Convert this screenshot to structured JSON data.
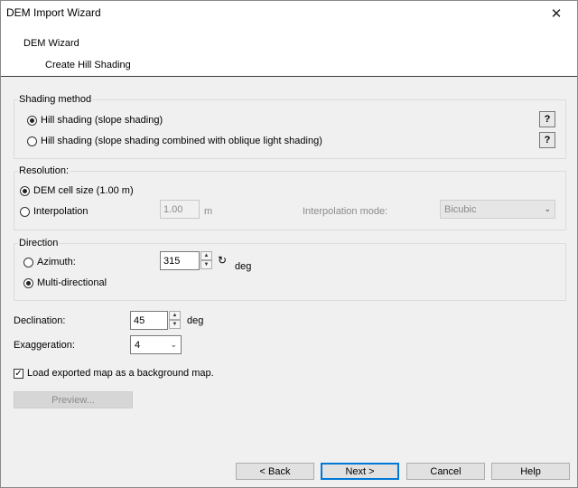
{
  "window": {
    "title": "DEM Import Wizard",
    "close_glyph": "✕"
  },
  "header": {
    "step_title": "DEM Wizard",
    "step_subtitle": "Create Hill Shading"
  },
  "shading": {
    "legend": "Shading method",
    "options": [
      {
        "label": "Hill shading (slope shading)",
        "selected": true
      },
      {
        "label": "Hill shading (slope shading combined with oblique light shading)",
        "selected": false
      }
    ],
    "help_label": "?"
  },
  "resolution": {
    "legend": "Resolution:",
    "dem_cell_label": "DEM cell size (1.00 m)",
    "interpolation_label": "Interpolation",
    "interp_value": "1.00",
    "unit": "m",
    "mode_label": "Interpolation mode:",
    "mode_value": "Bicubic"
  },
  "direction": {
    "legend": "Direction",
    "azimuth_label": "Azimuth:",
    "azimuth_value": "315",
    "reset_glyph": "↻",
    "unit": "deg",
    "multi_label": "Multi-directional"
  },
  "declination": {
    "label": "Declination:",
    "value": "45",
    "unit": "deg"
  },
  "exaggeration": {
    "label": "Exaggeration:",
    "value": "4"
  },
  "load_map": {
    "label": "Load exported map as a background map.",
    "checked": true
  },
  "preview_label": "Preview...",
  "buttons": {
    "back": "< Back",
    "next": "Next >",
    "cancel": "Cancel",
    "help": "Help"
  }
}
